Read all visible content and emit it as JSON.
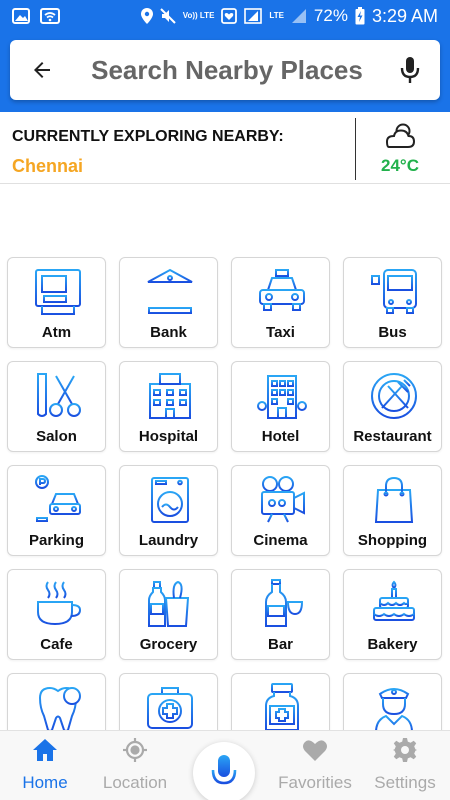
{
  "status_bar": {
    "volte_label": "Vo)) LTE",
    "lte_label": "LTE",
    "battery_percent": "72%",
    "time": "3:29 AM"
  },
  "header": {
    "title": "Search Nearby Places",
    "back_icon": "arrow-back-icon",
    "mic_icon": "microphone-icon"
  },
  "explore": {
    "label": "CURRENTLY EXPLORING NEARBY:",
    "city": "Chennai",
    "weather_icon": "cloudy-icon",
    "temperature": "24°C"
  },
  "categories": [
    {
      "label": "Atm",
      "icon": "atm-icon"
    },
    {
      "label": "Bank",
      "icon": "bank-icon"
    },
    {
      "label": "Taxi",
      "icon": "taxi-icon"
    },
    {
      "label": "Bus",
      "icon": "bus-icon"
    },
    {
      "label": "Salon",
      "icon": "salon-icon"
    },
    {
      "label": "Hospital",
      "icon": "hospital-icon"
    },
    {
      "label": "Hotel",
      "icon": "hotel-icon"
    },
    {
      "label": "Restaurant",
      "icon": "restaurant-icon"
    },
    {
      "label": "Parking",
      "icon": "parking-icon"
    },
    {
      "label": "Laundry",
      "icon": "laundry-icon"
    },
    {
      "label": "Cinema",
      "icon": "cinema-icon"
    },
    {
      "label": "Shopping",
      "icon": "shopping-icon"
    },
    {
      "label": "Cafe",
      "icon": "cafe-icon"
    },
    {
      "label": "Grocery",
      "icon": "grocery-icon"
    },
    {
      "label": "Bar",
      "icon": "bar-icon"
    },
    {
      "label": "Bakery",
      "icon": "bakery-icon"
    },
    {
      "label": "",
      "icon": "dentist-icon"
    },
    {
      "label": "",
      "icon": "first-aid-icon"
    },
    {
      "label": "",
      "icon": "pharmacy-icon"
    },
    {
      "label": "",
      "icon": "police-icon"
    }
  ],
  "bottom_nav": [
    {
      "label": "Home",
      "icon": "home-icon",
      "active": true
    },
    {
      "label": "Location",
      "icon": "location-target-icon",
      "active": false
    },
    {
      "label": "Favorities",
      "icon": "heart-icon",
      "active": false
    },
    {
      "label": "Settings",
      "icon": "gear-icon",
      "active": false
    }
  ],
  "colors": {
    "brand": "#1a73e8",
    "city": "#f5a623",
    "temperature": "#22b14c",
    "icon_gradient_start": "#2aa6f5",
    "icon_gradient_end": "#1a4fe0",
    "nav_inactive": "#aaaaaa"
  }
}
